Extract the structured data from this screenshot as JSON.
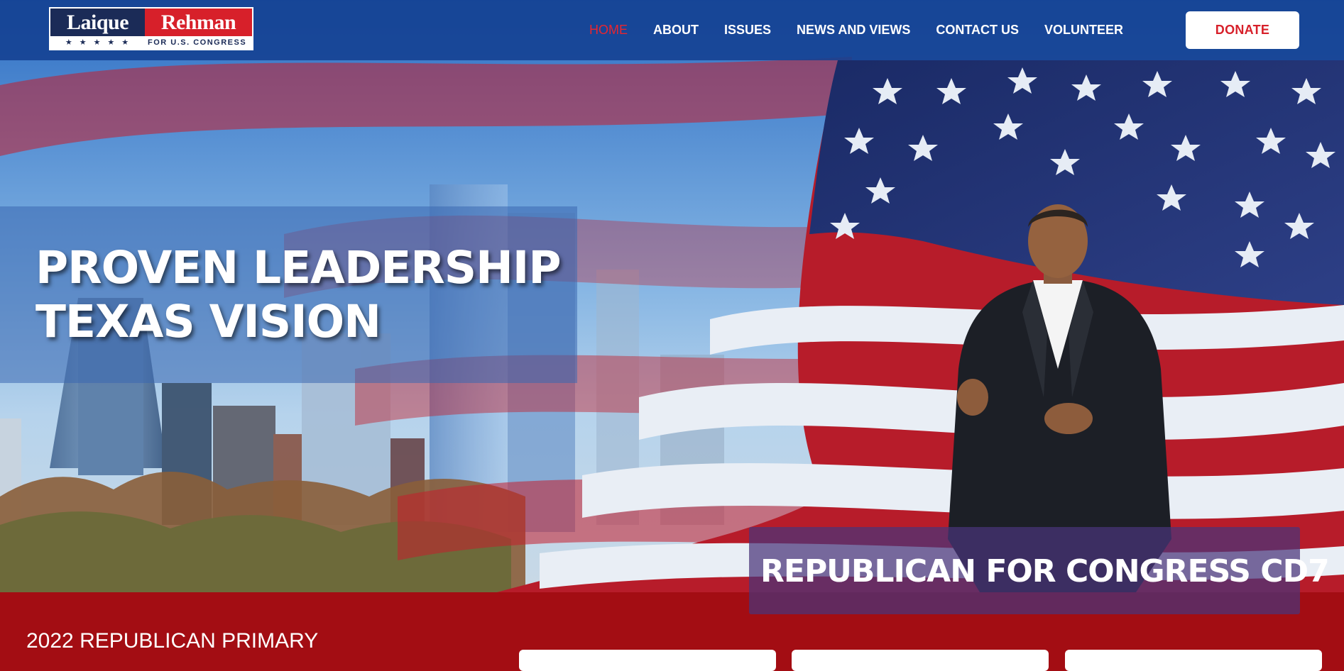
{
  "logo": {
    "first_name": "Laique",
    "last_name": "Rehman",
    "stars": "★★★★★",
    "subtitle": "FOR U.S. CONGRESS"
  },
  "nav": {
    "items": [
      {
        "label": "HOME",
        "active": true
      },
      {
        "label": "ABOUT",
        "active": false
      },
      {
        "label": "ISSUES",
        "active": false
      },
      {
        "label": "NEWS AND VIEWS",
        "active": false
      },
      {
        "label": "CONTACT US",
        "active": false
      },
      {
        "label": "VOLUNTEER",
        "active": false
      }
    ],
    "donate_label": "DONATE"
  },
  "hero": {
    "headline_line1": "PROVEN LEADERSHIP",
    "headline_line2": "TEXAS VISION",
    "tagline": "REPUBLICAN FOR CONGRESS CD7"
  },
  "section": {
    "title": "2022 REPUBLICAN PRIMARY"
  },
  "colors": {
    "header_blue": "#134091",
    "brand_red": "#d7202a",
    "section_red": "#a30d13",
    "active_nav": "#e8262f"
  }
}
